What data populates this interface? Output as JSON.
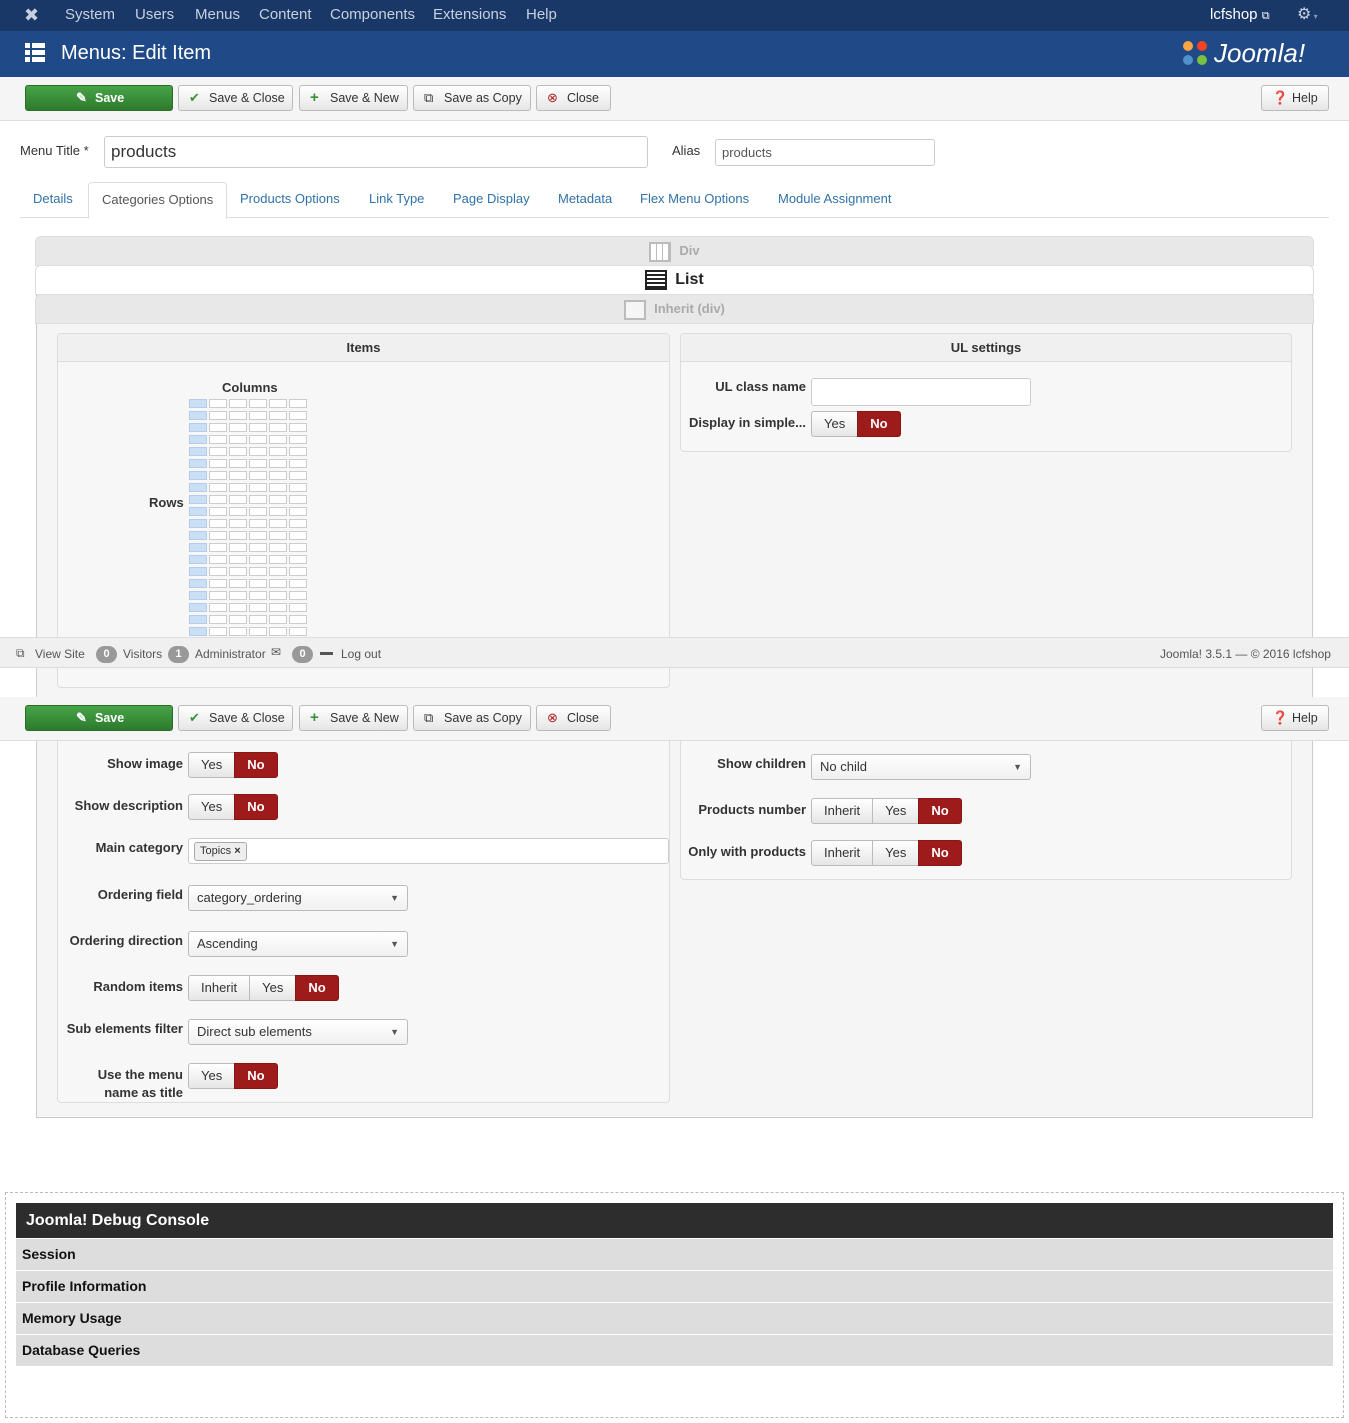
{
  "topnav": {
    "items": [
      "System",
      "Users",
      "Menus",
      "Content",
      "Components",
      "Extensions",
      "Help"
    ],
    "site_name": "lcfshop",
    "site_icon": "external-link-icon",
    "settings_icon": "gear-icon"
  },
  "header": {
    "title": "Menus: Edit Item",
    "logo_text": "Joomla!"
  },
  "toolbar": {
    "save": "Save",
    "save_close": "Save & Close",
    "save_new": "Save & New",
    "save_copy": "Save as Copy",
    "close": "Close",
    "help": "Help"
  },
  "form": {
    "menu_title_label": "Menu Title *",
    "menu_title_value": "products",
    "alias_label": "Alias",
    "alias_value": "products"
  },
  "tabs": [
    "Details",
    "Categories Options",
    "Products Options",
    "Link Type",
    "Page Display",
    "Metadata",
    "Flex Menu Options",
    "Module Assignment"
  ],
  "active_tab": "Categories Options",
  "layout_options": {
    "div": "Div",
    "list": "List",
    "inherit": "Inherit (div)"
  },
  "items_panel": {
    "title": "Items",
    "columns_label": "Columns",
    "rows_label": "Rows",
    "grid": {
      "columns": 6,
      "rows": 20,
      "selected_columns": 1
    }
  },
  "ul_panel": {
    "title": "UL settings",
    "ul_class_label": "UL class name",
    "ul_class_value": "",
    "display_simple_label": "Display in simple...",
    "yes": "Yes",
    "no": "No"
  },
  "statusbar": {
    "view_site": "View Site",
    "visitors_count": "0",
    "visitors": "Visitors",
    "admin_count": "1",
    "administrator": "Administrator",
    "messages_count": "0",
    "logout": "Log out",
    "version": "Joomla! 3.5.1 — © 2016 lcfshop"
  },
  "items_fields": {
    "show_image": "Show image",
    "show_description": "Show description",
    "main_category": "Main category",
    "main_category_tag": "Topics",
    "ordering_field": "Ordering field",
    "ordering_field_value": "category_ordering",
    "ordering_direction": "Ordering direction",
    "ordering_direction_value": "Ascending",
    "random_items": "Random items",
    "sub_elements_filter": "Sub elements filter",
    "sub_elements_value": "Direct sub elements",
    "use_menu_name_1": "Use the menu",
    "use_menu_name_2": "name as title",
    "inherit": "Inherit",
    "yes": "Yes",
    "no": "No"
  },
  "ul_fields": {
    "show_children": "Show children",
    "show_children_value": "No child",
    "products_number": "Products number",
    "only_with_products": "Only with products"
  },
  "debug": {
    "title": "Joomla! Debug Console",
    "sections": [
      "Session",
      "Profile Information",
      "Memory Usage",
      "Database Queries"
    ]
  },
  "colors": {
    "topnav_bg": "#1a3867",
    "header_bg": "#1f4a87",
    "save_green": "#3a903a",
    "toggle_active": "#9e1b1b",
    "link_blue": "#3071a9"
  }
}
